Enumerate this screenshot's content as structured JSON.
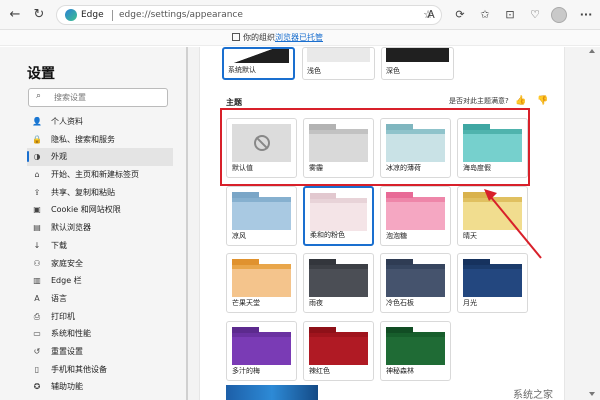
{
  "toolbar": {
    "back": "←",
    "refresh": "↻",
    "brand": "Edge",
    "url": "edge://settings/appearance",
    "icons": {
      "read_aloud": "A",
      "star": "☆",
      "ext": "⟳",
      "favorites": "✩",
      "collections": "⊡",
      "shield": "♡"
    }
  },
  "banner": {
    "text": "你的组织",
    "link": "浏览器已托管"
  },
  "sidebar": {
    "title": "设置",
    "search_placeholder": "搜索设置",
    "items": [
      {
        "label": "个人资料",
        "icon": "person-icon",
        "glyph": "👤"
      },
      {
        "label": "隐私、搜索和服务",
        "icon": "lock-icon",
        "glyph": "🔒"
      },
      {
        "label": "外观",
        "icon": "appearance-icon",
        "glyph": "◑",
        "active": true
      },
      {
        "label": "开始、主页和新建标签页",
        "icon": "home-icon",
        "glyph": "⌂"
      },
      {
        "label": "共享、复制和粘贴",
        "icon": "share-icon",
        "glyph": "⇪"
      },
      {
        "label": "Cookie 和网站权限",
        "icon": "cookie-icon",
        "glyph": "▣"
      },
      {
        "label": "默认浏览器",
        "icon": "browser-icon",
        "glyph": "▤"
      },
      {
        "label": "下载",
        "icon": "download-icon",
        "glyph": "↓"
      },
      {
        "label": "家庭安全",
        "icon": "family-icon",
        "glyph": "⚇"
      },
      {
        "label": "Edge 栏",
        "icon": "edge-bar-icon",
        "glyph": "▥"
      },
      {
        "label": "语言",
        "icon": "language-icon",
        "glyph": "A"
      },
      {
        "label": "打印机",
        "icon": "printer-icon",
        "glyph": "⎙"
      },
      {
        "label": "系统和性能",
        "icon": "system-icon",
        "glyph": "▭"
      },
      {
        "label": "重置设置",
        "icon": "reset-icon",
        "glyph": "↺"
      },
      {
        "label": "手机和其他设备",
        "icon": "phone-icon",
        "glyph": "▯"
      },
      {
        "label": "辅助功能",
        "icon": "accessibility-icon",
        "glyph": "✪"
      }
    ]
  },
  "modes": [
    {
      "label": "系统默认",
      "colors": [
        "#ffffff",
        "#1f1f1f"
      ]
    },
    {
      "label": "浅色",
      "colors": [
        "#e9e9e9",
        "#e9e9e9"
      ]
    },
    {
      "label": "深色",
      "colors": [
        "#202020",
        "#202020"
      ]
    }
  ],
  "theme_section": {
    "title": "主题",
    "feedback": "是否对此主题满意?"
  },
  "themes": [
    {
      "label": "默认值",
      "type": "default",
      "tab": "",
      "bar": "",
      "body": ""
    },
    {
      "label": "雾霾",
      "tab": "#b3b3b3",
      "bar": "#c2c2c2",
      "body": "#d9d9d9"
    },
    {
      "label": "冰凉的薄荷",
      "tab": "#7fb6bf",
      "bar": "#8fc3cb",
      "body": "#c9e2e6"
    },
    {
      "label": "海岛度假",
      "tab": "#3fa7a3",
      "bar": "#4fb3ad",
      "body": "#76d0cd"
    },
    {
      "label": "凉风",
      "tab": "#7aa6c7",
      "bar": "#86b0cf",
      "body": "#a9c9e2"
    },
    {
      "label": "柔和的粉色",
      "tab": "#e2c8cf",
      "bar": "#e8d3d8",
      "body": "#f4e4e7",
      "selected": true
    },
    {
      "label": "泡泡糖",
      "tab": "#e86a96",
      "bar": "#ee86a9",
      "body": "#f5a7c2"
    },
    {
      "label": "晴天",
      "tab": "#d9b24c",
      "bar": "#e0c060",
      "body": "#f1dd8f"
    },
    {
      "label": "芒果天堂",
      "tab": "#e0922e",
      "bar": "#e9a64a",
      "body": "#f4c48c"
    },
    {
      "label": "雨夜",
      "tab": "#33363c",
      "bar": "#3c3f45",
      "body": "#4b4e55"
    },
    {
      "label": "冷色石板",
      "tab": "#2f3c54",
      "bar": "#36455f",
      "body": "#45536d"
    },
    {
      "label": "月光",
      "tab": "#16325e",
      "bar": "#1b3b6b",
      "body": "#23477f"
    },
    {
      "label": "多汁的梅",
      "tab": "#5c2a8e",
      "bar": "#6a31a1",
      "body": "#7a3bb5"
    },
    {
      "label": "辣红色",
      "tab": "#8e1018",
      "bar": "#a0141d",
      "body": "#b01a24"
    },
    {
      "label": "神秘森林",
      "tab": "#114d24",
      "bar": "#175e2c",
      "body": "#1f6b35"
    }
  ],
  "watermark": "系统之家",
  "colors": {
    "accent": "#1a6fcf",
    "highlight": "#d8202a"
  }
}
